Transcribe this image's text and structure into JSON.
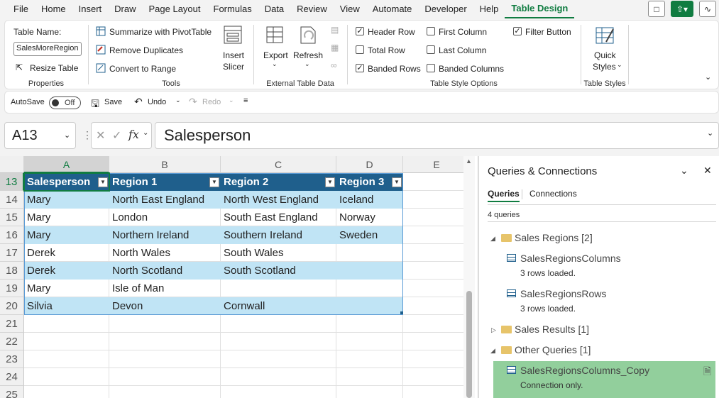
{
  "menu": {
    "items": [
      "File",
      "Home",
      "Insert",
      "Draw",
      "Page Layout",
      "Formulas",
      "Data",
      "Review",
      "View",
      "Automate",
      "Developer",
      "Help",
      "Table Design"
    ],
    "active": "Table Design"
  },
  "ribbon": {
    "properties": {
      "table_name_label": "Table Name:",
      "table_name_value": "SalesMoreRegion",
      "resize_table": "Resize Table",
      "group_label": "Properties"
    },
    "tools": {
      "summarize": "Summarize with PivotTable",
      "remove_duplicates": "Remove Duplicates",
      "convert_to_range": "Convert to Range",
      "insert_slicer_1": "Insert",
      "insert_slicer_2": "Slicer",
      "group_label": "Tools"
    },
    "external": {
      "export": "Export",
      "refresh": "Refresh",
      "group_label": "External Table Data"
    },
    "style_options": {
      "header_row": "Header Row",
      "total_row": "Total Row",
      "banded_rows": "Banded Rows",
      "first_column": "First Column",
      "last_column": "Last Column",
      "banded_columns": "Banded Columns",
      "filter_button": "Filter Button",
      "group_label": "Table Style Options"
    },
    "styles": {
      "quick_1": "Quick",
      "quick_2": "Styles",
      "group_label": "Table Styles"
    }
  },
  "qat": {
    "autosave": "AutoSave",
    "toggle_state": "Off",
    "save": "Save",
    "undo": "Undo",
    "redo": "Redo"
  },
  "formula_bar": {
    "name_box": "A13",
    "formula": "Salesperson"
  },
  "sheet": {
    "columns": [
      "A",
      "B",
      "C",
      "D",
      "E"
    ],
    "rows": [
      "13",
      "14",
      "15",
      "16",
      "17",
      "18",
      "19",
      "20",
      "21",
      "22",
      "23",
      "24",
      "25"
    ],
    "table_header": [
      "Salesperson",
      "Region 1",
      "Region 2",
      "Region 3"
    ],
    "table_rows": [
      [
        "Mary",
        "North East England",
        "North West England",
        "Iceland"
      ],
      [
        "Mary",
        "London",
        "South East England",
        "Norway"
      ],
      [
        "Mary",
        "Northern Ireland",
        "Southern Ireland",
        "Sweden"
      ],
      [
        "Derek",
        "North Wales",
        "South Wales",
        ""
      ],
      [
        "Derek",
        "North Scotland",
        "South Scotland",
        ""
      ],
      [
        "Mary",
        "Isle of Man",
        "",
        ""
      ],
      [
        "Silvia",
        "Devon",
        "Cornwall",
        ""
      ]
    ]
  },
  "queries_pane": {
    "title": "Queries & Connections",
    "tab_queries": "Queries",
    "tab_connections": "Connections",
    "count": "4 queries",
    "folder1": "Sales Regions [2]",
    "q1_name": "SalesRegionsColumns",
    "q1_status": "3 rows loaded.",
    "q2_name": "SalesRegionsRows",
    "q2_status": "3 rows loaded.",
    "folder2": "Sales Results [1]",
    "folder3": "Other Queries [1]",
    "q3_name": "SalesRegionsColumns_Copy",
    "q3_status": "Connection only."
  },
  "colors": {
    "accent": "#107c41",
    "table_header": "#1f5f8c",
    "band": "#c0e4f5",
    "selected_query": "#92cf9c"
  }
}
